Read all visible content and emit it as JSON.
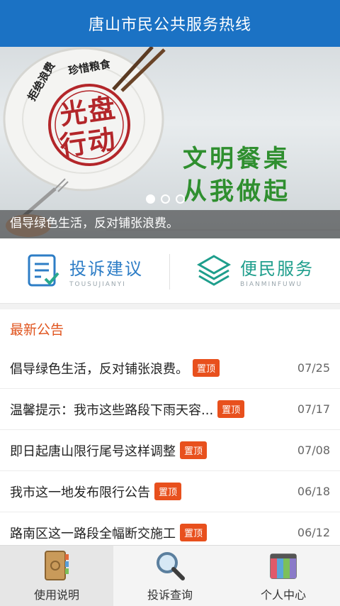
{
  "header": {
    "title": "唐山市民公共服务热线"
  },
  "banner": {
    "plate_arc_left": "拒绝浪费",
    "plate_arc_right": "珍惜粮食",
    "stamp_line1": "光盘",
    "stamp_line2": "行动",
    "slogan_line1": "文明餐桌",
    "slogan_line2": "从我做起",
    "caption": "倡导绿色生活，反对铺张浪费。",
    "dots_total": 3,
    "dots_active_index": 0
  },
  "quick": {
    "complaint": {
      "title": "投诉建议",
      "subtitle": "TOUSUJIANYI",
      "icon": "form-check-icon",
      "color": "#2d7dc6"
    },
    "service": {
      "title": "便民服务",
      "subtitle": "BIANMINFUWU",
      "icon": "layers-icon",
      "color": "#1e9e8c"
    }
  },
  "notices": {
    "heading": "最新公告",
    "items": [
      {
        "title": "倡导绿色生活，反对铺张浪费。",
        "badge": "置顶",
        "date": "07/25"
      },
      {
        "title": "温馨提示：我市这些路段下雨天容...",
        "badge": "置顶",
        "date": "07/17"
      },
      {
        "title": "即日起唐山限行尾号这样调整",
        "badge": "置顶",
        "date": "07/08"
      },
      {
        "title": "我市这一地发布限行公告",
        "badge": "置顶",
        "date": "06/18"
      },
      {
        "title": "路南区这一路段全幅断交施工",
        "badge": "置顶",
        "date": "06/12"
      }
    ]
  },
  "tabbar": {
    "items": [
      {
        "label": "使用说明",
        "icon": "notebook-icon"
      },
      {
        "label": "投诉查询",
        "icon": "magnifier-icon"
      },
      {
        "label": "个人中心",
        "icon": "calendar-icon"
      }
    ],
    "active_index": 0
  },
  "colors": {
    "header": "#1b72c4",
    "accent": "#e0551f",
    "badge": "#e8501d"
  }
}
